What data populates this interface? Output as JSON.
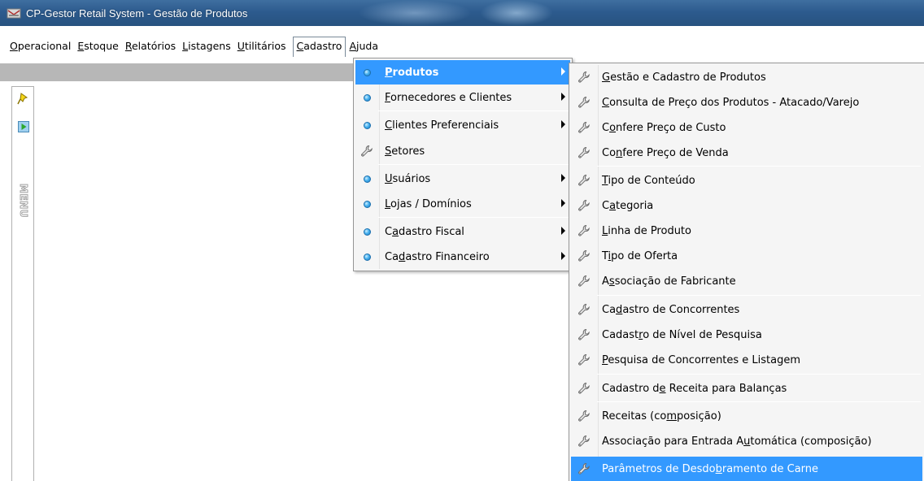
{
  "window": {
    "title": "CP-Gestor Retail System - Gestão de Produtos"
  },
  "menubar": {
    "items": [
      {
        "label": "Operacional",
        "underline": "O"
      },
      {
        "label": "Estoque",
        "underline": "E"
      },
      {
        "label": "Relatórios",
        "underline": "R"
      },
      {
        "label": "Listagens",
        "underline": "L"
      },
      {
        "label": "Utilitários",
        "underline": "U"
      },
      {
        "label": "Cadastro",
        "underline": "C"
      },
      {
        "label": "Ajuda",
        "underline": "A"
      }
    ]
  },
  "left_panel": {
    "vertical_label": "MENU"
  },
  "cadastro_menu": {
    "items": [
      {
        "label": "Produtos",
        "icon": "bullet-icon",
        "submenu": true,
        "highlighted": true
      },
      {
        "label": "Fornecedores e Clientes",
        "icon": "bullet-icon",
        "submenu": true
      },
      {
        "label": "Clientes Preferenciais",
        "icon": "bullet-icon",
        "submenu": true
      },
      {
        "label": "Setores",
        "icon": "wrench-icon",
        "submenu": false
      },
      {
        "label": "Usuários",
        "icon": "bullet-icon",
        "submenu": true
      },
      {
        "label": "Lojas / Domínios",
        "icon": "bullet-icon",
        "submenu": true
      },
      {
        "label": "Cadastro Fiscal",
        "icon": "bullet-icon",
        "submenu": true
      },
      {
        "label": "Cadastro Financeiro",
        "icon": "bullet-icon",
        "submenu": true
      }
    ]
  },
  "produtos_submenu": {
    "items": [
      {
        "label": "Gestão e Cadastro de Produtos",
        "icon": "wrench-icon"
      },
      {
        "label": "Consulta de Preço dos Produtos - Atacado/Varejo",
        "icon": "wrench-icon"
      },
      {
        "label": "Confere Preço de Custo",
        "icon": "wrench-icon"
      },
      {
        "label": "Confere Preço de Venda",
        "icon": "wrench-icon"
      },
      {
        "label": "Tipo de Conteúdo",
        "icon": "wrench-icon"
      },
      {
        "label": "Categoria",
        "icon": "wrench-icon"
      },
      {
        "label": "Linha de Produto",
        "icon": "wrench-icon"
      },
      {
        "label": "Tipo de Oferta",
        "icon": "wrench-icon"
      },
      {
        "label": "Associação de Fabricante",
        "icon": "wrench-icon"
      },
      {
        "label": "Cadastro de Concorrentes",
        "icon": "wrench-icon"
      },
      {
        "label": "Cadastro de Nível de Pesquisa",
        "icon": "wrench-icon"
      },
      {
        "label": "Pesquisa de Concorrentes e Listagem",
        "icon": "wrench-icon"
      },
      {
        "label": "Cadastro de Receita para Balanças",
        "icon": "wrench-icon"
      },
      {
        "label": "Receitas (composição)",
        "icon": "wrench-icon"
      },
      {
        "label": "Associação para Entrada Automática (composição)",
        "icon": "wrench-icon"
      },
      {
        "label": "Parâmetros de Desdobramento de Carne",
        "icon": "wrench-icon",
        "highlighted": true
      }
    ]
  },
  "colors": {
    "title_bar": "#2d5b8e",
    "highlight": "#3399ff",
    "toolstrip": "#b7b7b7"
  }
}
